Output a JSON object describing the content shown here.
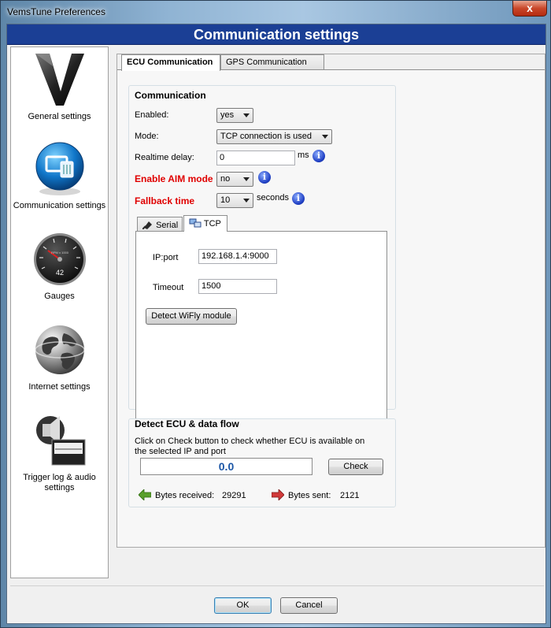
{
  "window": {
    "title": "VemsTune Preferences",
    "close_glyph": "x"
  },
  "header": {
    "title": "Communication settings"
  },
  "sidebar": {
    "items": [
      {
        "label": "General settings",
        "icon": "vems-logo-icon"
      },
      {
        "label": "Communication settings",
        "icon": "network-plug-icon"
      },
      {
        "label": "Gauges",
        "icon": "gauge-icon",
        "gauge_text": "RPM x 1000",
        "gauge_value": "42"
      },
      {
        "label": "Internet settings",
        "icon": "globe-icon"
      },
      {
        "label": "Trigger log & audio settings",
        "icon": "trigger-audio-icon"
      }
    ]
  },
  "tabs": [
    {
      "label": "ECU Communication",
      "active": true
    },
    {
      "label": "GPS Communication",
      "active": false
    }
  ],
  "communication": {
    "group_title": "Communication",
    "enabled_label": "Enabled:",
    "enabled_value": "yes",
    "mode_label": "Mode:",
    "mode_value": "TCP connection is used",
    "realtime_label": "Realtime delay:",
    "realtime_value": "0",
    "realtime_unit": "ms",
    "aim_label": "Enable AIM mode",
    "aim_value": "no",
    "fallback_label": "Fallback time",
    "fallback_value": "10",
    "fallback_unit": "seconds",
    "info_glyph": "i"
  },
  "subtabs": [
    {
      "label": "Serial",
      "active": false
    },
    {
      "label": "TCP",
      "active": true
    }
  ],
  "tcp": {
    "ip_label": "IP:port",
    "ip_value": "192.168.1.4:9000",
    "timeout_label": "Timeout",
    "timeout_value": "1500",
    "detect_button": "Detect WiFly module"
  },
  "detect": {
    "group_title": "Detect ECU & data flow",
    "description": "Click on Check button to check whether ECU is available on the selected IP and port",
    "value": "0.0",
    "check_button": "Check",
    "received_label": "Bytes received:",
    "received_value": "29291",
    "sent_label": "Bytes sent:",
    "sent_value": "2121"
  },
  "footer": {
    "ok_label": "OK",
    "cancel_label": "Cancel"
  },
  "colors": {
    "header_band": "#1b3f95",
    "warning_label": "#e00000",
    "value_text": "#1b56a6",
    "received_arrow": "#5aa02c",
    "sent_arrow": "#d13a3a"
  }
}
